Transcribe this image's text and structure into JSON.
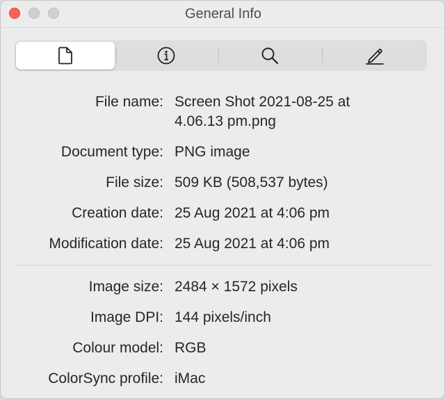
{
  "window": {
    "title": "General Info",
    "controls": [
      "close",
      "minimize",
      "zoom"
    ]
  },
  "toolbar": {
    "segments": [
      {
        "icon": "document-icon",
        "selected": true
      },
      {
        "icon": "info-icon",
        "selected": false
      },
      {
        "icon": "search-icon",
        "selected": false
      },
      {
        "icon": "pencil-icon",
        "selected": false
      }
    ]
  },
  "file_info": {
    "rows": [
      {
        "label": "File name:",
        "value": "Screen Shot 2021-08-25 at 4.06.13 pm.png"
      },
      {
        "label": "Document type:",
        "value": "PNG image"
      },
      {
        "label": "File size:",
        "value": "509 KB (508,537 bytes)"
      },
      {
        "label": "Creation date:",
        "value": "25 Aug 2021 at 4:06 pm"
      },
      {
        "label": "Modification date:",
        "value": "25 Aug 2021 at 4:06 pm"
      }
    ]
  },
  "image_info": {
    "rows": [
      {
        "label": "Image size:",
        "value": "2484 × 1572 pixels"
      },
      {
        "label": "Image DPI:",
        "value": "144 pixels/inch"
      },
      {
        "label": "Colour model:",
        "value": "RGB"
      },
      {
        "label": "ColorSync profile:",
        "value": "iMac"
      }
    ]
  },
  "colors": {
    "close": "#fe5f57",
    "inactive_control": "#d0d0d0",
    "background": "#ececec"
  }
}
